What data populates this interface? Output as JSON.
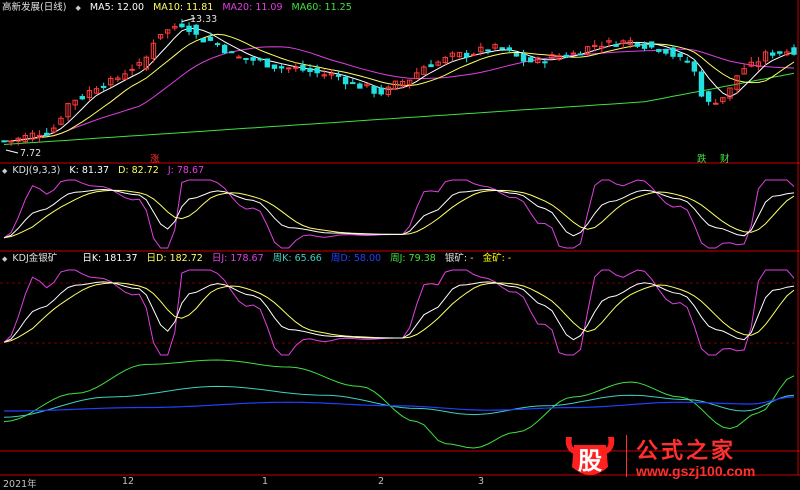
{
  "main_header": {
    "title": "高新发展(日线)",
    "ma5": "MA5: 12.00",
    "ma10": "MA10: 11.81",
    "ma20": "MA20: 11.09",
    "ma60": "MA60: 11.25"
  },
  "kdj_header": {
    "name": "KDJ(9,3,3)",
    "k": "K: 81.37",
    "d": "D: 82.72",
    "j": "J: 78.67"
  },
  "kdj2_header": {
    "name": "KDJ金银矿",
    "dk": "日K: 181.37",
    "dd": "日D: 182.72",
    "dj": "日J: 178.67",
    "wk": "周K: 65.66",
    "wd": "周D: 58.00",
    "wj": "周J: 79.38",
    "silver": "银矿: -",
    "gold": "金矿: -"
  },
  "annotations": {
    "high": "13.33",
    "low": "7.72",
    "zhang": "涨",
    "die": "跌",
    "cai": "财"
  },
  "x_axis_labels": [
    "2021年",
    "12",
    "1",
    "2",
    "3"
  ],
  "watermark": {
    "logo_char": "股",
    "text": "公式之家",
    "url": "www.gszj100.com"
  },
  "colors": {
    "up": "#ff3b3b",
    "down": "#22e0e0",
    "ma5": "#ffffff",
    "ma10": "#ffff66",
    "ma20": "#e040e0",
    "ma60": "#40e040",
    "divider": "#cc0000",
    "grid": "#7a0000"
  },
  "chart_data": [
    {
      "type": "candlestick",
      "title": "高新发展(日线)",
      "price_high": 13.33,
      "price_low": 7.72,
      "series": [
        {
          "name": "MA5",
          "last": 12.0
        },
        {
          "name": "MA10",
          "last": 11.81
        },
        {
          "name": "MA20",
          "last": 11.09
        },
        {
          "name": "MA60",
          "last": 11.25
        }
      ],
      "x_ticks": [
        "2021年",
        "12",
        "1",
        "2",
        "3"
      ]
    },
    {
      "type": "line",
      "title": "KDJ(9,3,3)",
      "series": [
        {
          "name": "K",
          "last": 81.37
        },
        {
          "name": "D",
          "last": 82.72
        },
        {
          "name": "J",
          "last": 78.67
        }
      ]
    },
    {
      "type": "line",
      "title": "KDJ金银矿",
      "series": [
        {
          "name": "日K",
          "last": 181.37
        },
        {
          "name": "日D",
          "last": 182.72
        },
        {
          "name": "日J",
          "last": 178.67
        },
        {
          "name": "周K",
          "last": 65.66
        },
        {
          "name": "周D",
          "last": 58.0
        },
        {
          "name": "周J",
          "last": 79.38
        }
      ]
    }
  ]
}
